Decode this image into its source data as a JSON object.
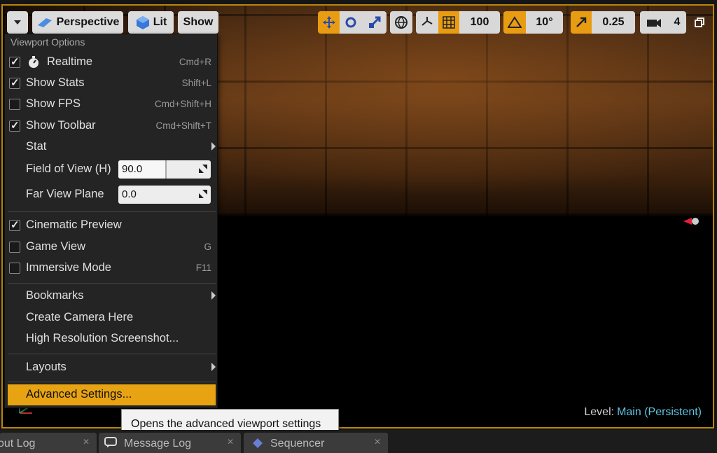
{
  "toolbar": {
    "menu_toggle_icon": "chevron-down-icon",
    "perspective_label": "Perspective",
    "lit_label": "Lit",
    "show_label": "Show",
    "grid_snap_value": "100",
    "rotation_snap_value": "10°",
    "scale_snap_value": "0.25",
    "camera_speed_value": "4"
  },
  "menu": {
    "header": "Viewport Options",
    "realtime": {
      "label": "Realtime",
      "shortcut": "Cmd+R"
    },
    "show_stats": {
      "label": "Show Stats",
      "shortcut": "Shift+L",
      "checked": true
    },
    "show_fps": {
      "label": "Show FPS",
      "shortcut": "Cmd+Shift+H",
      "checked": false
    },
    "show_toolbar": {
      "label": "Show Toolbar",
      "shortcut": "Cmd+Shift+T",
      "checked": true
    },
    "stat": {
      "label": "Stat"
    },
    "fov": {
      "label": "Field of View (H)",
      "value": "90.0"
    },
    "far_view": {
      "label": "Far View Plane",
      "value": "0.0"
    },
    "cinematic_preview": {
      "label": "Cinematic Preview",
      "checked": true
    },
    "game_view": {
      "label": "Game View",
      "shortcut": "G",
      "checked": false
    },
    "immersive_mode": {
      "label": "Immersive Mode",
      "shortcut": "F11",
      "checked": false
    },
    "bookmarks": {
      "label": "Bookmarks"
    },
    "create_camera": {
      "label": "Create Camera Here"
    },
    "high_res_screenshot": {
      "label": "High Resolution Screenshot..."
    },
    "layouts": {
      "label": "Layouts"
    },
    "advanced_settings": {
      "label": "Advanced Settings..."
    }
  },
  "tooltip": {
    "text": "Opens the advanced viewport settings"
  },
  "viewport": {
    "level_label": "Level:",
    "level_value": "Main (Persistent)"
  },
  "tabs": [
    {
      "label": "out Log"
    },
    {
      "label": "Message Log"
    },
    {
      "label": "Sequencer"
    }
  ],
  "colors": {
    "accent": "#e8a313",
    "frame": "#b8860b",
    "level_value": "#5fc3e0"
  }
}
